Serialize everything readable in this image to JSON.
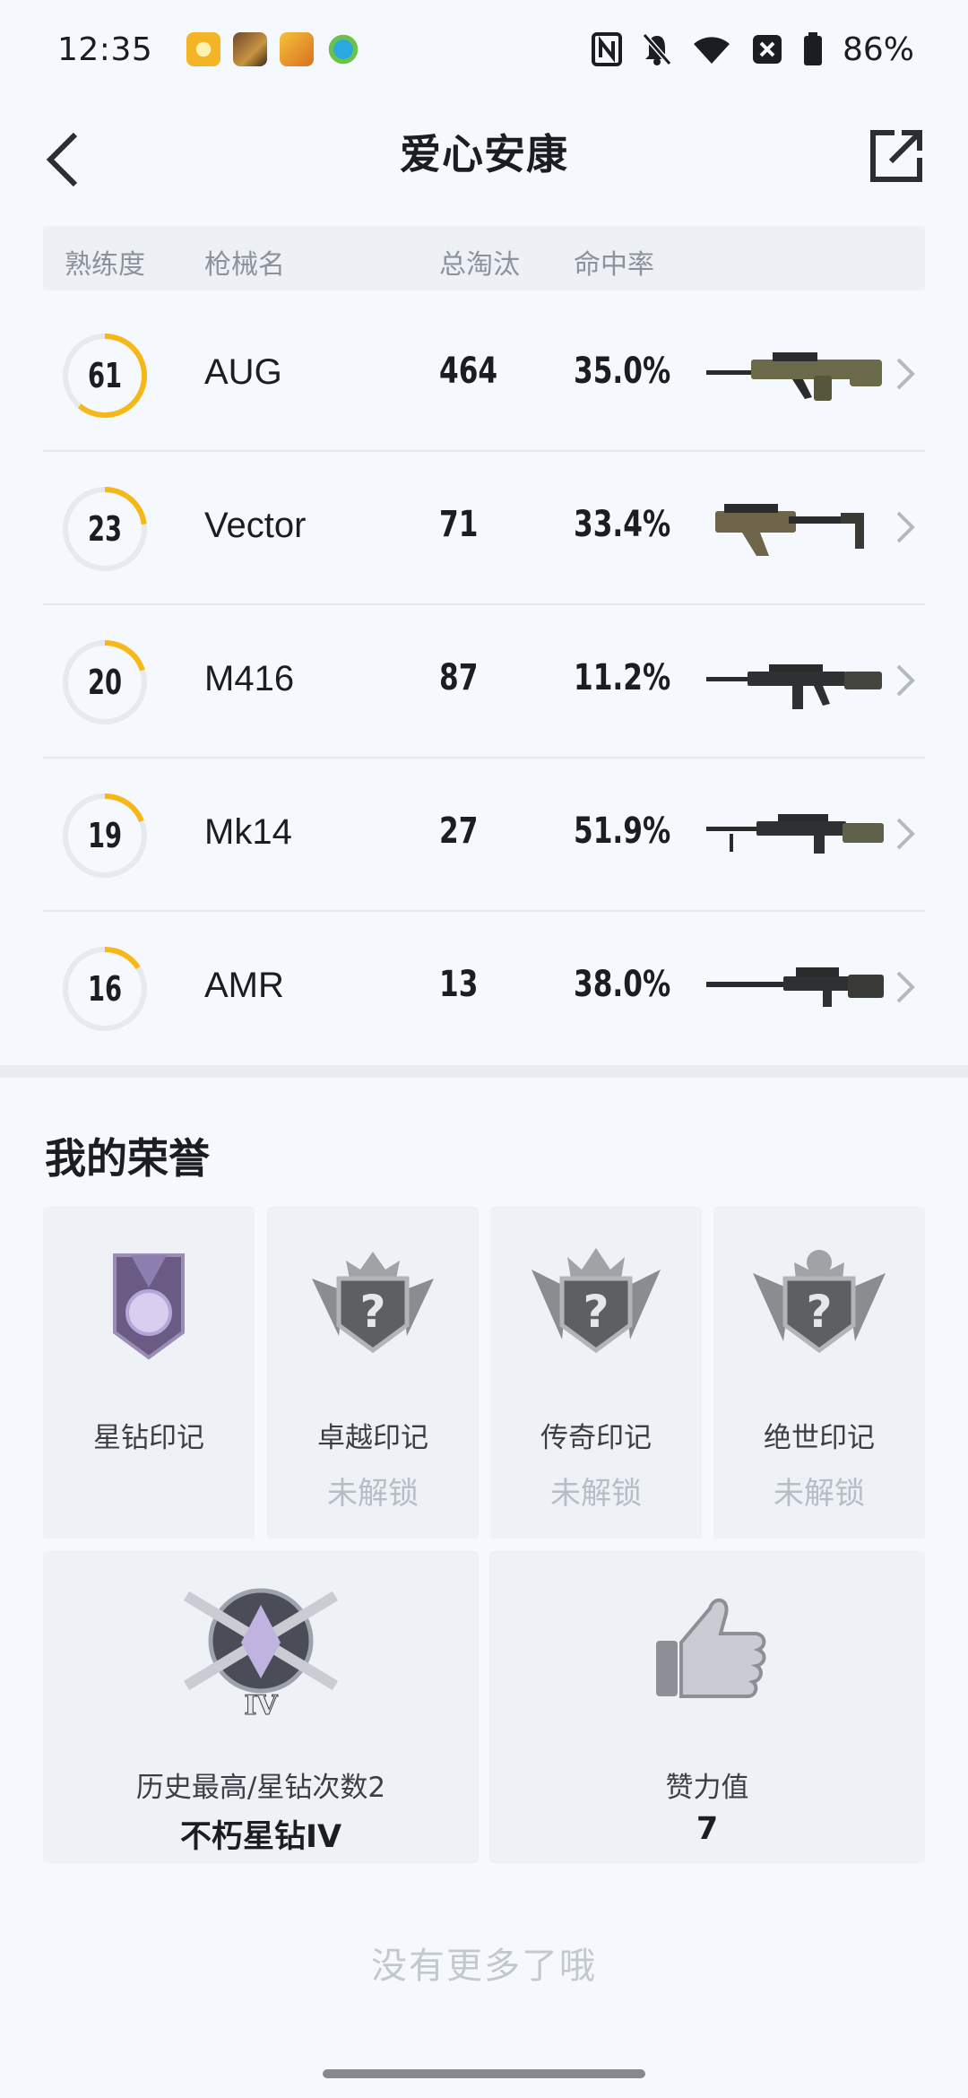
{
  "status_bar": {
    "time": "12:35",
    "battery": "86%",
    "icons": [
      "nfc-icon",
      "mute-icon",
      "wifi-icon",
      "sim-off-icon",
      "battery-icon"
    ]
  },
  "header": {
    "title": "爱心安康",
    "back_icon": "chevron-left-icon",
    "share_icon": "share-external-icon"
  },
  "weapons_table": {
    "columns": [
      "熟练度",
      "枪械名",
      "总淘汰",
      "命中率"
    ],
    "rows": [
      {
        "proficiency": "61",
        "proficiency_level": 0.61,
        "name": "AUG",
        "kills": "464",
        "hit_rate": "35.0%"
      },
      {
        "proficiency": "23",
        "proficiency_level": 0.23,
        "name": "Vector",
        "kills": "71",
        "hit_rate": "33.4%"
      },
      {
        "proficiency": "20",
        "proficiency_level": 0.2,
        "name": "M416",
        "kills": "87",
        "hit_rate": "11.2%"
      },
      {
        "proficiency": "19",
        "proficiency_level": 0.19,
        "name": "Mk14",
        "kills": "27",
        "hit_rate": "51.9%"
      },
      {
        "proficiency": "16",
        "proficiency_level": 0.16,
        "name": "AMR",
        "kills": "13",
        "hit_rate": "38.0%"
      }
    ]
  },
  "honors": {
    "title": "我的荣誉",
    "badges": [
      {
        "label": "星钻印记",
        "sub": ""
      },
      {
        "label": "卓越印记",
        "sub": "未解锁"
      },
      {
        "label": "传奇印记",
        "sub": "未解锁"
      },
      {
        "label": "绝世印记",
        "sub": "未解锁"
      }
    ],
    "highest_rank": {
      "label": "历史最高/星钻次数2",
      "value": "不朽星钻IV",
      "tier": "IV"
    },
    "likes": {
      "label": "赞力值",
      "value": "7"
    }
  },
  "footer": {
    "no_more": "没有更多了哦"
  },
  "colors": {
    "accent": "#f5b817",
    "ring_track": "#e6e9ee",
    "background": "#f5f8fc"
  }
}
